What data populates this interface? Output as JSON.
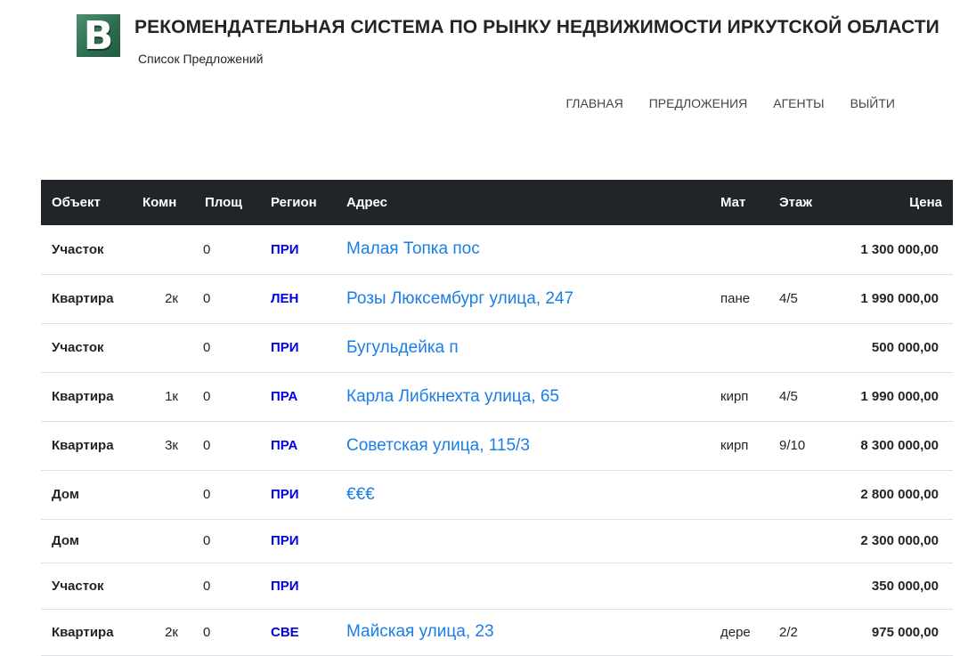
{
  "header": {
    "logo_letter": "B",
    "title": "РЕКОМЕНДАТЕЛЬНАЯ СИСТЕМА ПО РЫНКУ НЕДВИЖИМОСТИ ИРКУТСКОЙ ОБЛАСТИ",
    "subtitle": "Список Предложений"
  },
  "nav": {
    "items": [
      {
        "label": "ГЛАВНАЯ"
      },
      {
        "label": "ПРЕДЛОЖЕНИЯ"
      },
      {
        "label": "АГЕНТЫ"
      },
      {
        "label": "ВЫЙТИ"
      }
    ]
  },
  "table": {
    "columns": [
      "Объект",
      "Комн",
      "Площ",
      "Регион",
      "Адрес",
      "Мат",
      "Этаж",
      "Цена"
    ],
    "rows": [
      {
        "object": "Участок",
        "rooms": "",
        "area": "0",
        "region": "ПРИ",
        "address": "Малая Топка пос",
        "material": "",
        "floor": "",
        "price": "1 300 000,00"
      },
      {
        "object": "Квартира",
        "rooms": "2к",
        "area": "0",
        "region": "ЛЕН",
        "address": "Розы Люксембург улица, 247",
        "material": "пане",
        "floor": "4/5",
        "price": "1 990 000,00"
      },
      {
        "object": "Участок",
        "rooms": "",
        "area": "0",
        "region": "ПРИ",
        "address": "Бугульдейка п",
        "material": "",
        "floor": "",
        "price": "500 000,00"
      },
      {
        "object": "Квартира",
        "rooms": "1к",
        "area": "0",
        "region": "ПРА",
        "address": "Карла Либкнехта улица, 65",
        "material": "кирп",
        "floor": "4/5",
        "price": "1 990 000,00"
      },
      {
        "object": "Квартира",
        "rooms": "3к",
        "area": "0",
        "region": "ПРА",
        "address": "Советская улица, 115/3",
        "material": "кирп",
        "floor": "9/10",
        "price": "8 300 000,00"
      },
      {
        "object": "Дом",
        "rooms": "",
        "area": "0",
        "region": "ПРИ",
        "address": "€€€",
        "material": "",
        "floor": "",
        "price": "2 800 000,00"
      },
      {
        "object": "Дом",
        "rooms": "",
        "area": "0",
        "region": "ПРИ",
        "address": "",
        "material": "",
        "floor": "",
        "price": "2 300 000,00"
      },
      {
        "object": "Участок",
        "rooms": "",
        "area": "0",
        "region": "ПРИ",
        "address": "",
        "material": "",
        "floor": "",
        "price": "350 000,00"
      },
      {
        "object": "Квартира",
        "rooms": "2к",
        "area": "0",
        "region": "СВЕ",
        "address": "Майская улица, 23",
        "material": "дере",
        "floor": "2/2",
        "price": "975 000,00"
      }
    ]
  },
  "colors": {
    "header_bg": "#212529",
    "link": "#1a7ee6",
    "region": "#0000dd",
    "logo": "#2f6d51"
  }
}
